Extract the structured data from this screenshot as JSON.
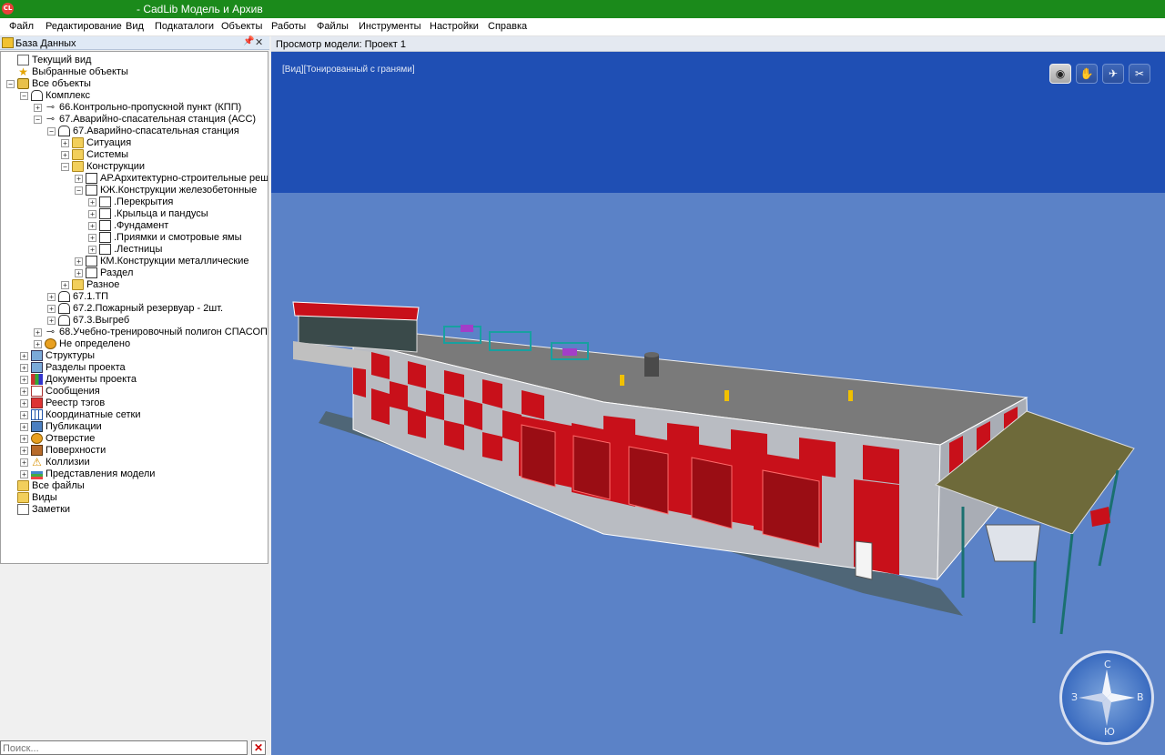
{
  "app": {
    "icon_text": "CL",
    "title": "- CadLib Модель и Архив"
  },
  "menu": [
    "Файл",
    "Редактирование",
    "Вид",
    "Подкаталоги",
    "Объекты",
    "Работы",
    "Файлы",
    "Инструменты",
    "Настройки",
    "Справка"
  ],
  "left_panel": {
    "title": "База Данных",
    "pin_icon": "pin-icon",
    "close_label": "✕",
    "search_placeholder": "Поиск...",
    "search_clear_label": "✕",
    "tree": [
      {
        "label": "Текущий вид",
        "icon": "current-view-icon",
        "level": 0,
        "expander": ""
      },
      {
        "label": "Выбранные объекты",
        "icon": "star-icon",
        "level": 0,
        "expander": ""
      },
      {
        "label": "Все объекты",
        "icon": "database-icon",
        "level": 0,
        "expander": "−"
      },
      {
        "label": "Комплекс",
        "icon": "building-icon",
        "level": 1,
        "expander": "−"
      },
      {
        "label": "66.Контрольно-пропускной пункт (КПП)",
        "icon": "site-icon",
        "level": 2,
        "expander": "+"
      },
      {
        "label": "67.Аварийно-спасательная станция (АСС)",
        "icon": "site-icon",
        "level": 2,
        "expander": "−"
      },
      {
        "label": "67.Аварийно-спасательная станция",
        "icon": "building-icon",
        "level": 3,
        "expander": "−"
      },
      {
        "label": "Ситуация",
        "icon": "folder-icon",
        "level": 4,
        "expander": "+"
      },
      {
        "label": "Системы",
        "icon": "folder-icon",
        "level": 4,
        "expander": "+"
      },
      {
        "label": "Конструкции",
        "icon": "folder-open-icon",
        "level": 4,
        "expander": "−"
      },
      {
        "label": "АР.Архитектурно-строительные решения",
        "icon": "part-icon",
        "level": 5,
        "expander": "+"
      },
      {
        "label": "КЖ.Конструкции железобетонные",
        "icon": "part-icon",
        "level": 5,
        "expander": "−"
      },
      {
        "label": ".Перекрытия",
        "icon": "part-icon",
        "level": 6,
        "expander": "+"
      },
      {
        "label": ".Крыльца и пандусы",
        "icon": "part-icon",
        "level": 6,
        "expander": "+"
      },
      {
        "label": ".Фундамент",
        "icon": "part-icon",
        "level": 6,
        "expander": "+"
      },
      {
        "label": ".Приямки и смотровые ямы",
        "icon": "part-icon",
        "level": 6,
        "expander": "+"
      },
      {
        "label": ".Лестницы",
        "icon": "part-icon",
        "level": 6,
        "expander": "+"
      },
      {
        "label": "КМ.Конструкции металлические",
        "icon": "part-icon",
        "level": 5,
        "expander": "+"
      },
      {
        "label": "Раздел",
        "icon": "part-icon",
        "level": 5,
        "expander": "+"
      },
      {
        "label": "Разное",
        "icon": "folder-icon",
        "level": 4,
        "expander": "+"
      },
      {
        "label": "67.1.ТП",
        "icon": "building-icon",
        "level": 3,
        "expander": "+"
      },
      {
        "label": "67.2.Пожарный резервуар - 2шт.",
        "icon": "building-icon",
        "level": 3,
        "expander": "+"
      },
      {
        "label": "67.3.Выгреб",
        "icon": "building-icon",
        "level": 3,
        "expander": "+"
      },
      {
        "label": "68.Учебно-тренировочный полигон СПАСОП",
        "icon": "site-icon",
        "level": 2,
        "expander": "+"
      },
      {
        "label": "Не определено",
        "icon": "undefined-icon",
        "level": 2,
        "expander": "+"
      },
      {
        "label": "Структуры",
        "icon": "structure-icon",
        "level": 1,
        "expander": "+"
      },
      {
        "label": "Разделы проекта",
        "icon": "sections-icon",
        "level": 1,
        "expander": "+"
      },
      {
        "label": "Документы проекта",
        "icon": "books-icon",
        "level": 1,
        "expander": "+"
      },
      {
        "label": "Сообщения",
        "icon": "mail-icon",
        "level": 1,
        "expander": "+"
      },
      {
        "label": "Реестр тэгов",
        "icon": "tag-icon",
        "level": 1,
        "expander": "+"
      },
      {
        "label": "Координатные сетки",
        "icon": "grid-icon",
        "level": 1,
        "expander": "+"
      },
      {
        "label": "Публикации",
        "icon": "publication-icon",
        "level": 1,
        "expander": "+"
      },
      {
        "label": "Отверстие",
        "icon": "hole-icon",
        "level": 1,
        "expander": "+"
      },
      {
        "label": "Поверхности",
        "icon": "surface-icon",
        "level": 1,
        "expander": "+"
      },
      {
        "label": "Коллизии",
        "icon": "warning-icon",
        "level": 1,
        "expander": "+"
      },
      {
        "label": "Представления модели",
        "icon": "layers-icon",
        "level": 1,
        "expander": "+"
      },
      {
        "label": "Все файлы",
        "icon": "folder-icon",
        "level": 0,
        "expander": ""
      },
      {
        "label": "Виды",
        "icon": "folder-icon",
        "level": 0,
        "expander": ""
      },
      {
        "label": "Заметки",
        "icon": "notes-icon",
        "level": 0,
        "expander": ""
      }
    ]
  },
  "viewer": {
    "tab_title": "Просмотр модели: Проект 1",
    "view_mode": "[Вид][Тонированный с гранями]",
    "toolbar": [
      {
        "name": "view-eye",
        "icon": "eye-icon",
        "glyph": "◉",
        "active": true
      },
      {
        "name": "walk",
        "icon": "walk-icon",
        "glyph": "✋",
        "active": false
      },
      {
        "name": "fly",
        "icon": "plane-icon",
        "glyph": "✈",
        "active": false
      },
      {
        "name": "section",
        "icon": "section-icon",
        "glyph": "✂",
        "active": false
      }
    ],
    "compass": {
      "n": "С",
      "e": "В",
      "s": "Ю",
      "w": "З"
    }
  },
  "colors": {
    "titlebar": "#1b8a1b",
    "sky": "#1f4fb4",
    "ground": "#5b82c7",
    "facade_red": "#c8101a",
    "facade_grey": "#b9bcc2",
    "roof": "#7a7a7a",
    "canopy": "#6e6a3a"
  }
}
